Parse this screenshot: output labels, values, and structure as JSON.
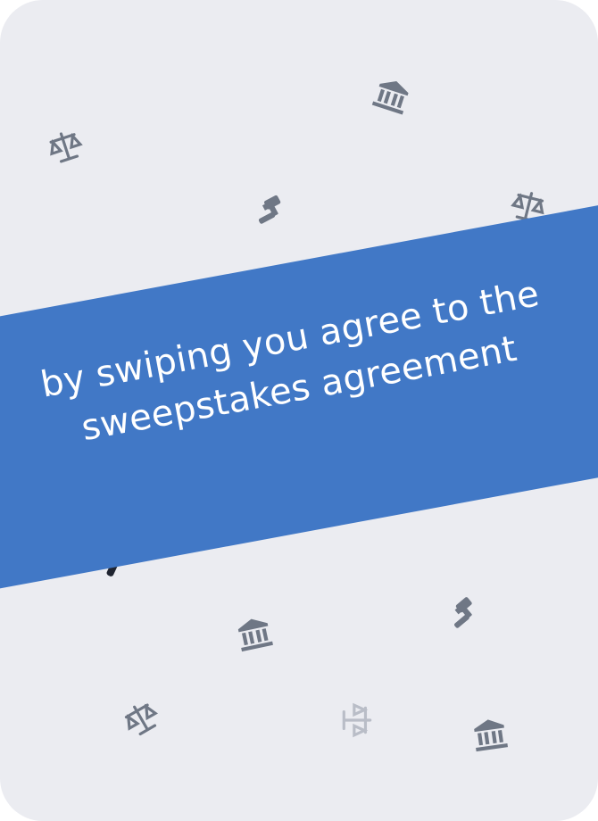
{
  "card": {
    "message": "by swiping you agree to the sweepstakes agreement"
  },
  "colors": {
    "card_background": "#ebecf1",
    "band": "#4178c6",
    "icon": "#6f7785",
    "icon_faded": "#b9bdc7",
    "text": "#ffffff"
  },
  "icons": [
    {
      "name": "bank-icon"
    },
    {
      "name": "scales-icon"
    },
    {
      "name": "gavel-icon"
    },
    {
      "name": "scales-icon"
    },
    {
      "name": "bank-icon"
    },
    {
      "name": "gavel-icon"
    },
    {
      "name": "scales-icon"
    },
    {
      "name": "scales-icon",
      "faded": true
    },
    {
      "name": "bank-icon"
    }
  ]
}
